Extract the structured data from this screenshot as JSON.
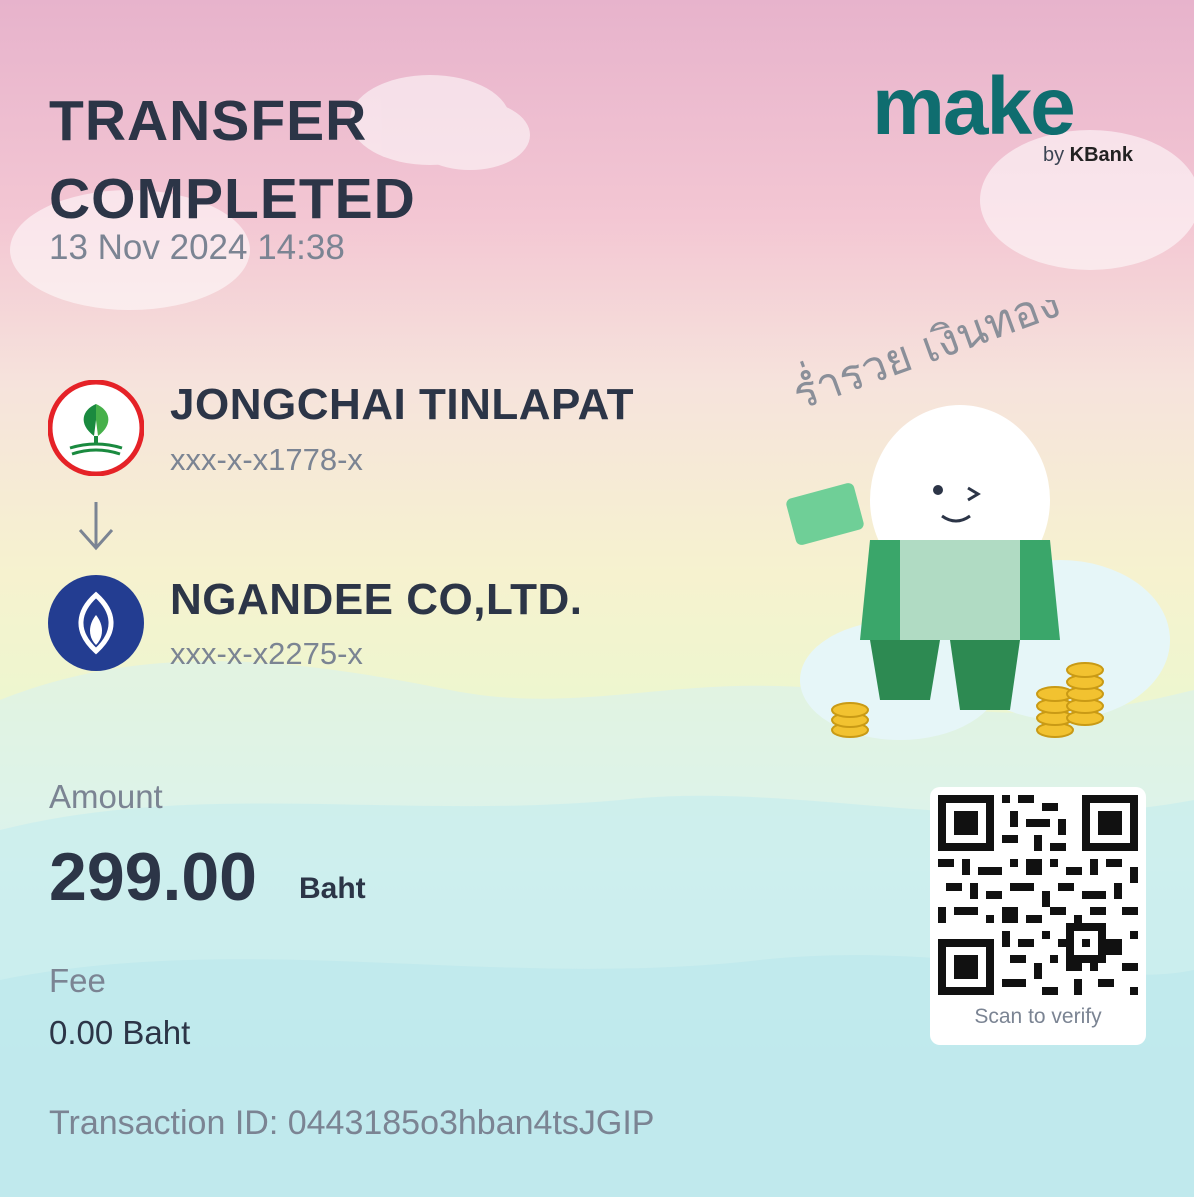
{
  "header": {
    "title_line1": "TRANSFER",
    "title_line2": "COMPLETED",
    "datetime": "13 Nov 2024 14:38"
  },
  "brand": {
    "name": "make",
    "by_prefix": "by",
    "by_bank": "KBank",
    "color": "#0f6d6f"
  },
  "sender": {
    "name": "JONGCHAI TINLAPAT",
    "account": "xxx-x-x1778-x",
    "bank_icon": "kbank-icon",
    "bank_color": "#1a8a3f"
  },
  "receiver": {
    "name": "NGANDEE CO,LTD.",
    "account": "xxx-x-x2275-x",
    "bank_icon": "bangkok-bank-icon",
    "bank_color": "#233d91"
  },
  "amount": {
    "label": "Amount",
    "value": "299.00",
    "unit": "Baht"
  },
  "fee": {
    "label": "Fee",
    "value": "0.00 Baht"
  },
  "transaction": {
    "text": "Transaction ID: 0443185o3hban4tsJGIP"
  },
  "qr": {
    "caption": "Scan to verify"
  },
  "decoration": {
    "thai_text": "ร่ำรวย เงินทอง"
  }
}
